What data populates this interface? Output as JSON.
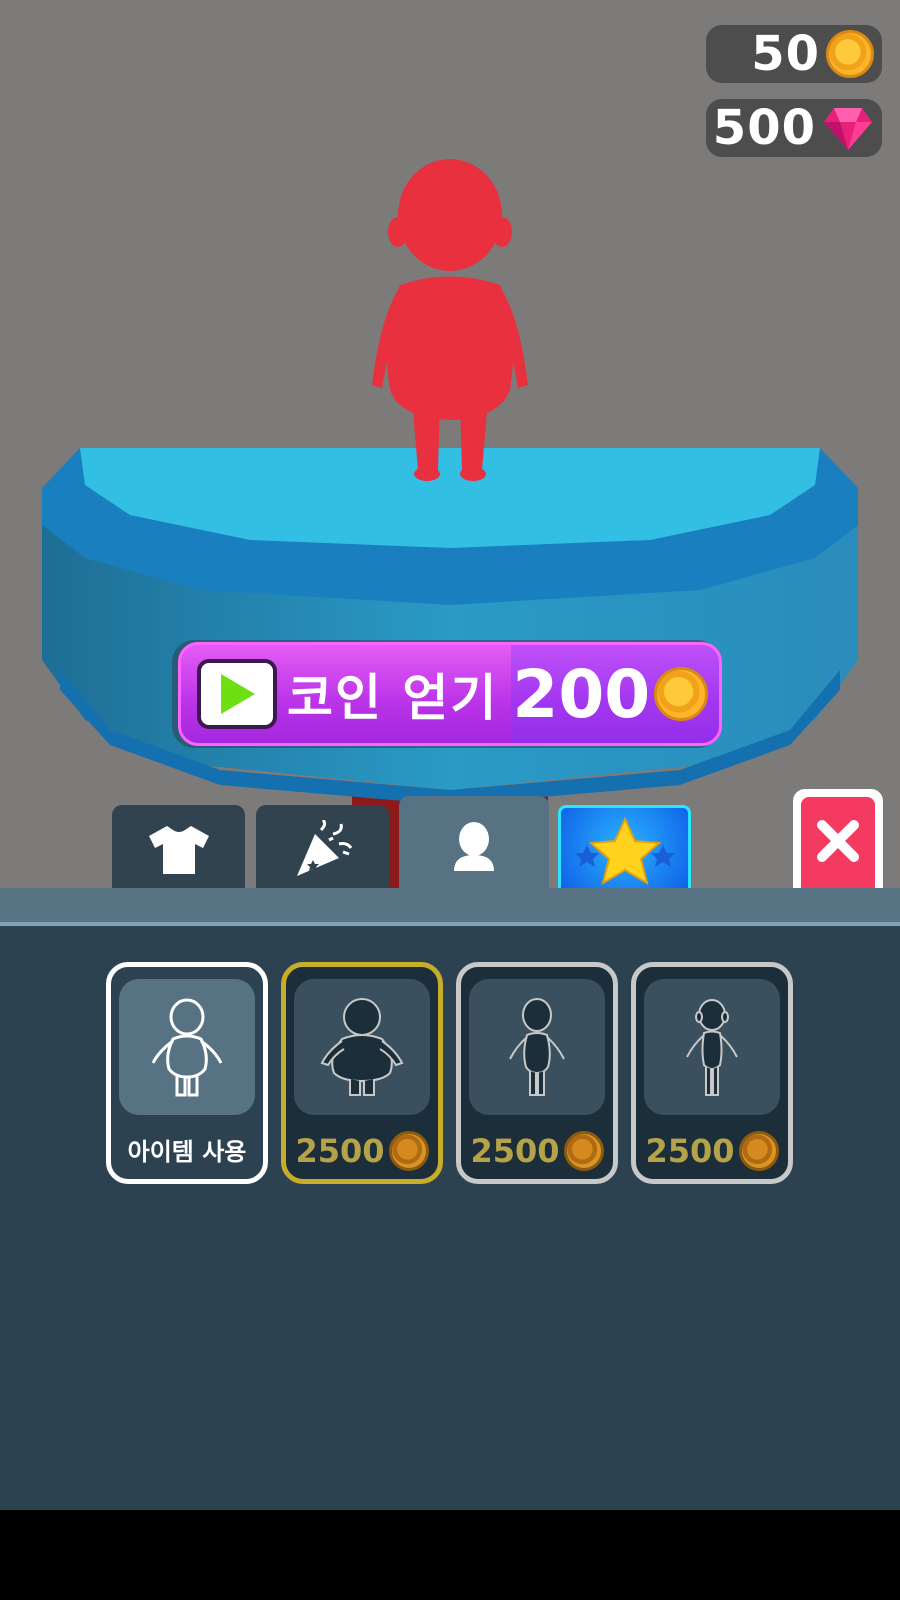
{
  "hud": {
    "coins": "50",
    "gems": "500"
  },
  "ad_button": {
    "label": "코인 얻기",
    "amount": "200"
  },
  "tabs": [
    {
      "name": "tab-clothes",
      "icon": "t-shirt-icon",
      "active": false
    },
    {
      "name": "tab-effects",
      "icon": "party-popper-icon",
      "active": false
    },
    {
      "name": "tab-body",
      "icon": "head-silhouette-icon",
      "active": true
    },
    {
      "name": "tab-special",
      "icon": "star-icon",
      "active": false
    }
  ],
  "items": [
    {
      "label": "아이템 사용",
      "state": "equipped",
      "icon": "body-chubby-icon"
    },
    {
      "price": "2500",
      "state": "highlighted",
      "icon": "body-fat-icon"
    },
    {
      "price": "2500",
      "state": "locked",
      "icon": "body-slim-icon"
    },
    {
      "price": "2500",
      "state": "locked",
      "icon": "body-thin-icon"
    }
  ],
  "colors": {
    "background": "#7d7b79",
    "panel": "#2d4250",
    "accent_purple": "#b933e8",
    "close_red": "#f53a62",
    "character_red": "#e8303f",
    "platform_blue": "#2bb8dd"
  }
}
